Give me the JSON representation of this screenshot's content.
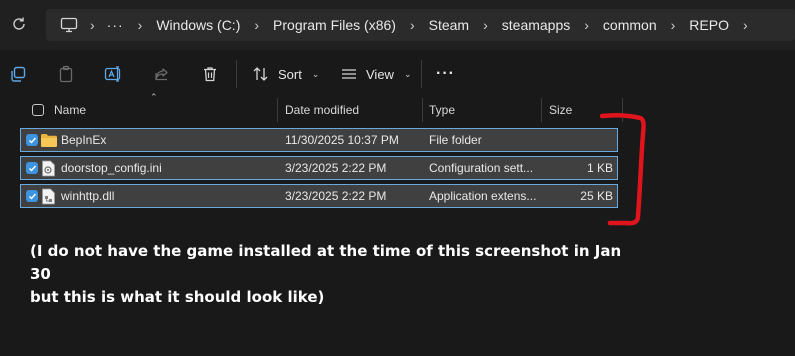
{
  "breadcrumb": [
    {
      "label": "Windows (C:)"
    },
    {
      "label": "Program Files (x86)"
    },
    {
      "label": "Steam"
    },
    {
      "label": "steamapps"
    },
    {
      "label": "common"
    },
    {
      "label": "REPO"
    }
  ],
  "toolbar": {
    "sort_label": "Sort",
    "view_label": "View",
    "more_label": "···"
  },
  "columns": {
    "name": "Name",
    "date": "Date modified",
    "type": "Type",
    "size": "Size"
  },
  "files": [
    {
      "name": "BepInEx",
      "date": "11/30/2025 10:37 PM",
      "type": "File folder",
      "size": "",
      "icon": "folder-icon",
      "selected": true
    },
    {
      "name": "doorstop_config.ini",
      "date": "3/23/2025 2:22 PM",
      "type": "Configuration sett...",
      "size": "1 KB",
      "icon": "config-file-icon",
      "selected": true
    },
    {
      "name": "winhttp.dll",
      "date": "3/23/2025 2:22 PM",
      "type": "Application extens...",
      "size": "25 KB",
      "icon": "dll-file-icon",
      "selected": true
    }
  ],
  "annotation": {
    "line1": "(I do not have the game installed at the time of this screenshot in Jan 30",
    "line2": "but this is what it should look like)"
  },
  "colors": {
    "selection_border": "#6aa9dc",
    "checkbox_checked": "#3c93e0",
    "annotation_bracket": "#e0141c"
  }
}
